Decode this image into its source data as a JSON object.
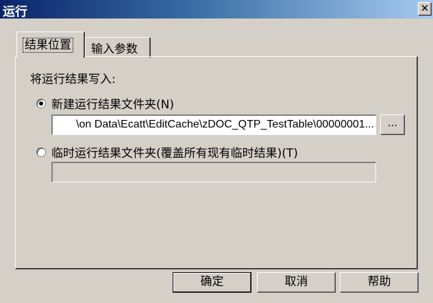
{
  "window": {
    "title": "运行",
    "close_glyph": "✕"
  },
  "tabs": [
    {
      "label": "结果位置",
      "active": true
    },
    {
      "label": "输入参数",
      "active": false
    }
  ],
  "section_label": "将运行结果写入:",
  "options": {
    "new_folder": {
      "label": "新建运行结果文件夹(N)",
      "selected": true,
      "path_value": "...on Data\\Ecatt\\EditCache\\zDOC_QTP_TestTable\\00000001\\",
      "browse_label": "..."
    },
    "temp_folder": {
      "label": "临时运行结果文件夹(覆盖所有现有临时结果)(T)",
      "selected": false,
      "path_value": ""
    }
  },
  "buttons": {
    "ok": "确定",
    "cancel": "取消",
    "help": "帮助"
  }
}
